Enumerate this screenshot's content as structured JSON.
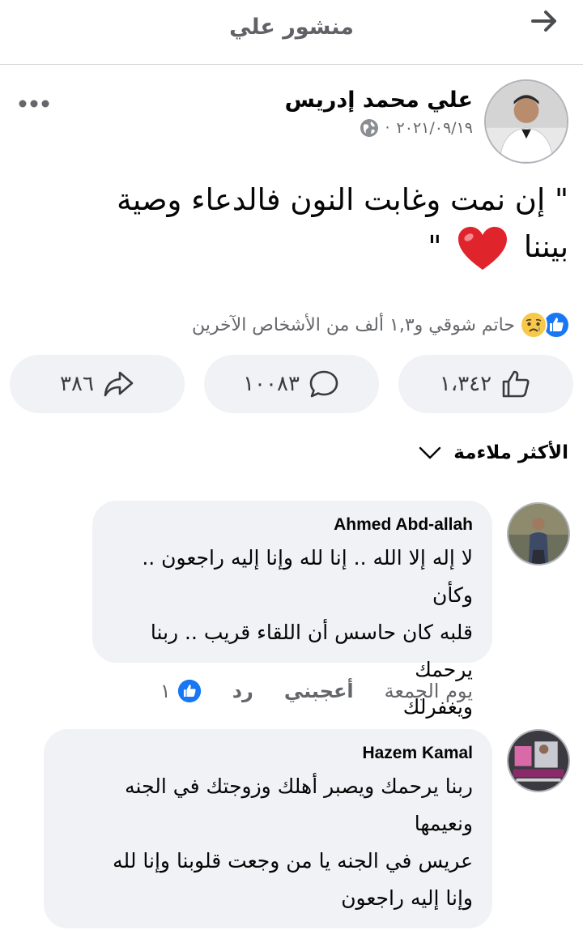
{
  "header": {
    "title": "منشور علي"
  },
  "post": {
    "author": "علي محمد إدريس",
    "date": "٢٠٢١/٠٩/١٩",
    "separator": "·",
    "text_line1": "\" إن نمت وغابت النون فالدعاء وصية",
    "text_line2_prefix": "بيننا",
    "text_line2_suffix": "\"",
    "reactions_summary": "حاتم شوقي و١,٣ ألف من الأشخاص الآخرين",
    "likes_count": "١،٣٤٢",
    "comments_count": "١٠٠٨٣",
    "shares_count": "٣٨٦"
  },
  "sort": {
    "label": "الأكثر ملاءمة"
  },
  "comments": [
    {
      "name": "Ahmed Abd-allah",
      "text": "لا إله إلا الله .. إنا لله وإنا إليه راجعون .. وكأن\nقلبه كان حاسس أن اللقاء قريب .. ربنا يرحمك\nويغفرلك",
      "time": "يوم الجمعة",
      "like_label": "أعجبني",
      "reply_label": "رد",
      "like_count": "١"
    },
    {
      "name": "Hazem Kamal",
      "text": "ربنا يرحمك ويصبر أهلك وزوجتك في الجنه\nونعيمها\nعريس في الجنه يا من وجعت قلوبنا وإنا لله\nوإنا إليه راجعون"
    }
  ],
  "colors": {
    "accent": "#1877f2",
    "bubble": "#f0f2f5",
    "muted": "#65676b",
    "heart": "#e0242b"
  }
}
